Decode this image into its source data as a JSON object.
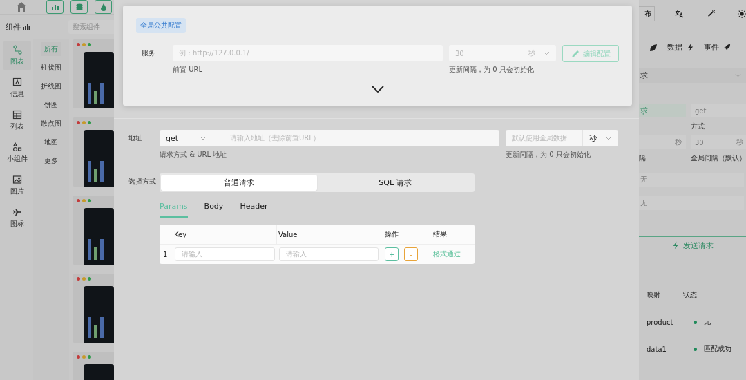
{
  "topbar": {
    "publish_label": "布"
  },
  "component_panel": {
    "title": "组件",
    "search_placeholder": "搜索组件"
  },
  "categories": [
    {
      "label": "图表",
      "kind": "chart",
      "selected": true
    },
    {
      "label": "信息",
      "kind": "info",
      "selected": false
    },
    {
      "label": "列表",
      "kind": "table",
      "selected": false
    },
    {
      "label": "小组件",
      "kind": "widget",
      "selected": false
    },
    {
      "label": "图片",
      "kind": "image",
      "selected": false
    },
    {
      "label": "图标",
      "kind": "plane",
      "selected": false
    }
  ],
  "chart_types": [
    {
      "label": "所有",
      "selected": true
    },
    {
      "label": "柱状图",
      "selected": false
    },
    {
      "label": "折线图",
      "selected": false
    },
    {
      "label": "饼图",
      "selected": false
    },
    {
      "label": "散点图",
      "selected": false
    },
    {
      "label": "地图",
      "selected": false
    },
    {
      "label": "更多",
      "selected": false
    }
  ],
  "global_config": {
    "badge": "全局公共配置",
    "service_label": "服务",
    "url_placeholder": "例：http://127.0.0.1/",
    "url_hint": "前置 URL",
    "interval_value": "30",
    "interval_unit": "秒",
    "interval_hint": "更新间隔，为 0 只会初始化",
    "edit_button": "编辑配置"
  },
  "request": {
    "address_label": "地址",
    "method": "get",
    "url_placeholder": "请输入地址（去除前置URL）",
    "address_hint": "请求方式 & URL 地址",
    "interval_placeholder": "默认使用全局数据",
    "interval_unit": "秒",
    "interval_hint": "更新间隔，为 0 只会初始化",
    "mode_label": "选择方式",
    "modes": [
      {
        "label": "普通请求",
        "selected": true
      },
      {
        "label": "SQL 请求",
        "selected": false
      }
    ],
    "tabs": [
      {
        "label": "Params",
        "selected": true
      },
      {
        "label": "Body",
        "selected": false
      },
      {
        "label": "Header",
        "selected": false
      }
    ],
    "table": {
      "columns": [
        "Key",
        "Value",
        "操作",
        "结果"
      ],
      "rows": [
        {
          "index": "1",
          "key_placeholder": "请输入",
          "value_placeholder": "请输入",
          "add": "+",
          "remove": "-",
          "result": "格式通过"
        }
      ]
    }
  },
  "right_panel": {
    "tabs": [
      {
        "label": "数据",
        "kind": "bolt"
      },
      {
        "label": "事件",
        "kind": "rocket"
      }
    ],
    "select_value": "求",
    "request_type": "求",
    "method_placeholder": "get",
    "method_label": "方式",
    "interval_unit": "秒",
    "global_interval_value": "30",
    "global_interval_unit": "秒",
    "interval_label": "隔",
    "global_interval_label": "全局间隔（默认）",
    "field_1": "无",
    "field_2": "无",
    "send_button": "发送请求",
    "mapping_columns": [
      "映射",
      "状态"
    ],
    "mapping_rows": [
      {
        "name": "product",
        "status": "无",
        "color": "#1f8a5a"
      },
      {
        "name": "data1",
        "status": "匹配成功",
        "color": "#1f8a5a"
      }
    ]
  }
}
